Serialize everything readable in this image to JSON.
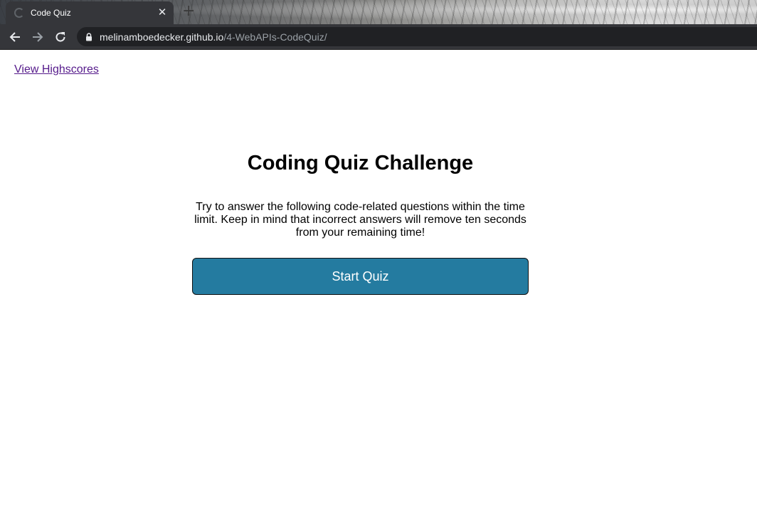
{
  "browser": {
    "tab_title": "Code Quiz",
    "tab_close": "✕",
    "new_tab": "+",
    "url_host": "melinamboedecker.github.io",
    "url_path": "/4-WebAPIs-CodeQuiz/",
    "icons": [
      "back-arrow-icon",
      "forward-arrow-icon",
      "reload-icon",
      "lock-icon",
      "favicon-loading-icon"
    ]
  },
  "page": {
    "highscores_link": "View Highscores",
    "title": "Coding Quiz Challenge",
    "description": "Try to answer the following code-related questions within the time limit. Keep in mind that incorrect answers will remove ten seconds from your remaining time!",
    "start_button": "Start Quiz"
  },
  "colors": {
    "start_button_bg": "#247ba0",
    "link_visited": "#551a8b",
    "chrome_dark": "#35363a"
  }
}
